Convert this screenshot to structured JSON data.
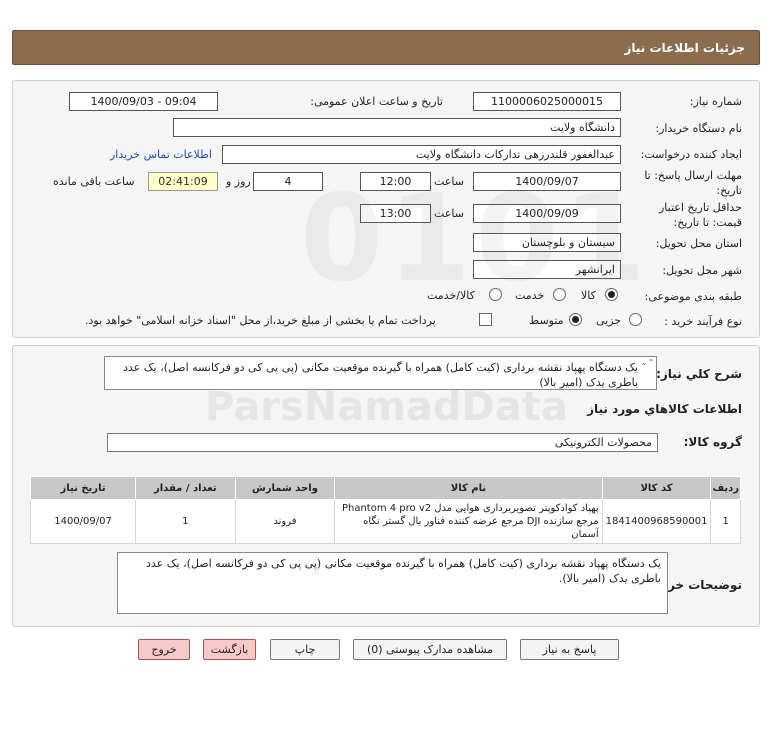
{
  "header": {
    "title": "جزئیات اطلاعات نیاز"
  },
  "fields": {
    "need_number_label": "شماره نیاز:",
    "need_number": "1100006025000015",
    "announce_label": "تاریخ و ساعت اعلان عمومی:",
    "announce_value": "1400/09/03 - 09:04",
    "buyer_org_label": "نام دستگاه خریدار:",
    "buyer_org": "دانشگاه ولایت",
    "creator_label": "ایجاد کننده درخواست:",
    "creator": "عبدالغفور قلندرزهی تدارکات دانشگاه ولایت",
    "contact_link": "اطلاعات تماس خریدار",
    "deadline_label_1": "مهلت ارسال پاسخ: تا",
    "deadline_label_2": "تاریخ:",
    "deadline_date": "1400/09/07",
    "time_label": "ساعت",
    "deadline_time": "12:00",
    "days_value": "4",
    "days_label": "روز و",
    "remaining_time": "02:41:09",
    "remaining_label": "ساعت باقی مانده",
    "validity_label_1": "حداقل تاریخ اعتبار",
    "validity_label_2": "قیمت: تا تاریخ:",
    "validity_date": "1400/09/09",
    "validity_time": "13:00",
    "province_label": "استان محل تحویل:",
    "province": "سیستان و بلوچستان",
    "city_label": "شهر محل تحویل:",
    "city": "ایرانشهر",
    "category_label": "طبقه بندی موضوعی:",
    "category_options": [
      "کالا",
      "خدمت",
      "کالا/خدمت"
    ],
    "process_label": "نوع فرآیند خرید :",
    "process_options": [
      "جزیی",
      "متوسط"
    ],
    "payment_note": "پرداخت تمام یا بخشی از مبلغ خرید،از محل \"اسناد خزانه اسلامی\" خواهد بود."
  },
  "summary": {
    "label": "شرح کلي نياز:",
    "text": "یک دستگاه پهپاد نقشه برداری (کیت کامل) همراه با گیرنده موقعیت مکانی (پی پی کی دو فرکانسه اصل)، یک عدد باطری یدک (امیر بالا)"
  },
  "goods": {
    "section_title": "اطلاعات کالاهاي مورد نياز",
    "group_label": "گروه کالا:",
    "group_value": "محصولات الکترونیکی",
    "columns": [
      "ردیف",
      "کد کالا",
      "نام کالا",
      "واحد شمارش",
      "تعداد / مقدار",
      "تاریخ نیاز"
    ],
    "rows": [
      {
        "index": "1",
        "code": "1841400968590001",
        "name": "پهپاد کوادکوپتر تصویربرداری هوایی مدل Phantom 4 pro v2 مرجع سازنده DJI مرجع عرضه کننده فناور بال گستر نگاه آسمان",
        "unit": "فروند",
        "qty": "1",
        "date": "1400/09/07"
      }
    ]
  },
  "buyer_notes": {
    "label": "توضیحات خریدار:",
    "text": "یک دستگاه پهپاد نقشه برداری (کیت کامل) همراه با گیرنده موقعیت مکانی (پی پی کی دو فرکانسه اصل)، یک عدد باطری یدک (امیر بالا)."
  },
  "buttons": {
    "reply": "پاسخ به نیاز",
    "attachments": "مشاهده مدارک پیوستی (0)",
    "print": "چاپ",
    "back": "بازگشت",
    "exit": "خروج"
  },
  "watermark": {
    "brand": "ParsNamadData"
  },
  "colors": {
    "header": "#8b6d4e",
    "exit_button": "#f7c9c9",
    "link": "#1a4fbf"
  }
}
